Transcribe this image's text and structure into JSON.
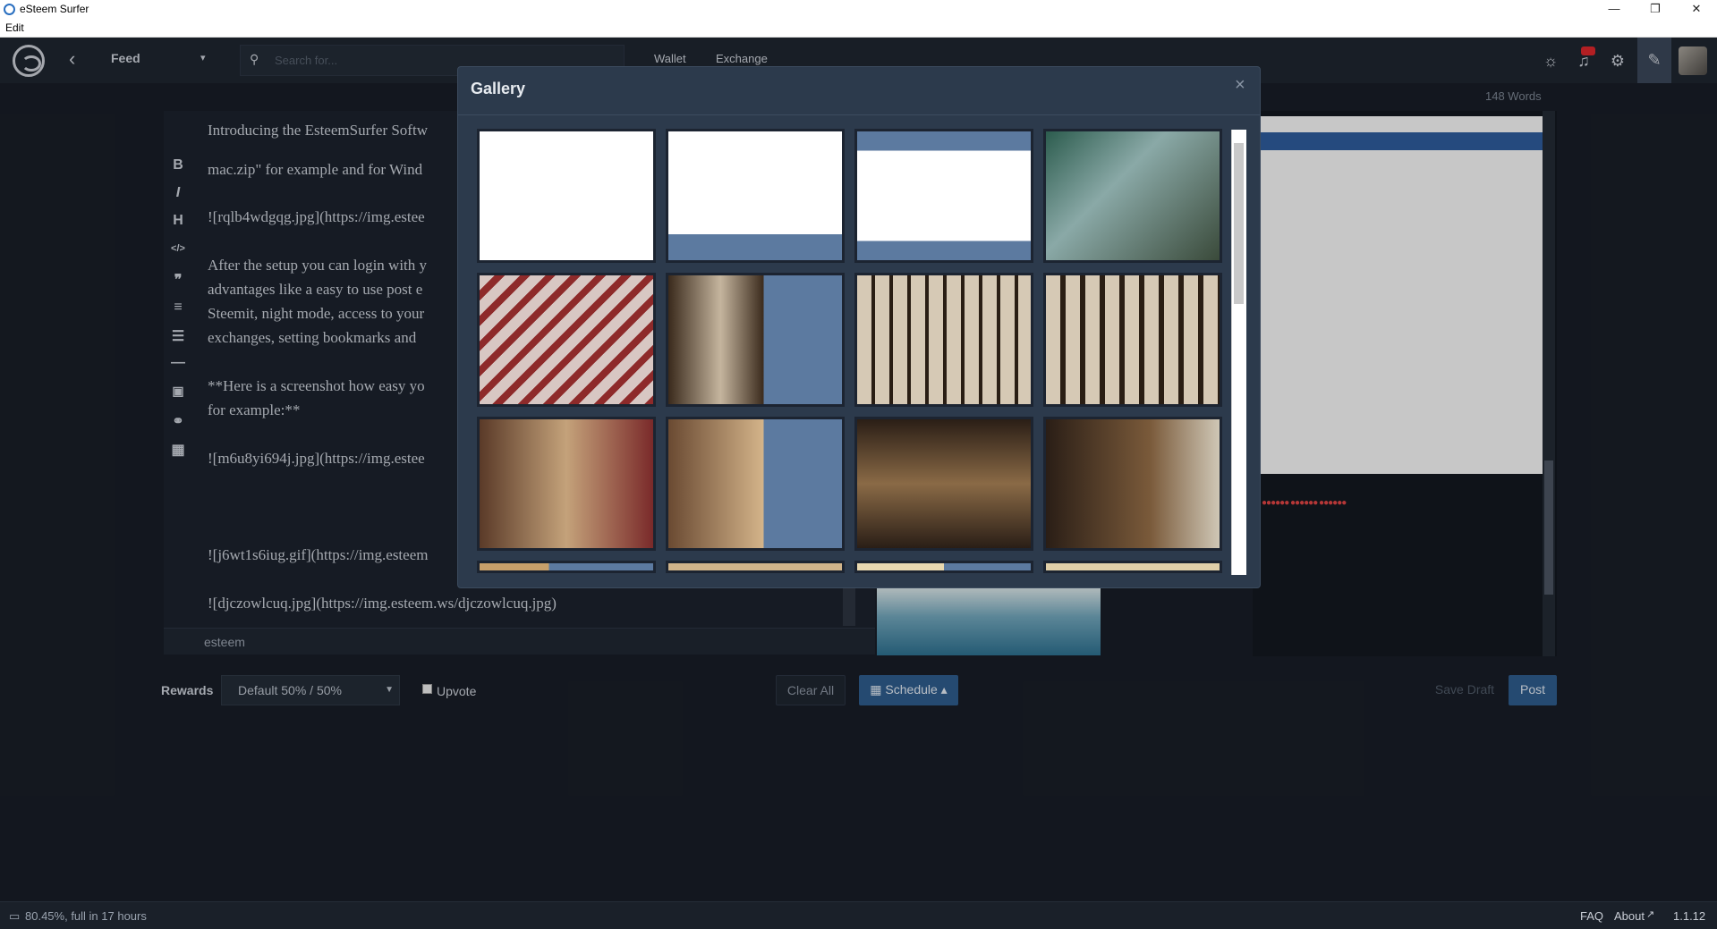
{
  "window": {
    "title": "eSteem Surfer",
    "menu": "Edit",
    "min": "—",
    "max": "❐",
    "close": "✕"
  },
  "nav": {
    "back": "‹",
    "feed": "Feed",
    "caret": "▾",
    "search_placeholder": "Search for...",
    "wallet": "Wallet",
    "exchange": "Exchange",
    "icons": [
      "back-icon",
      "search-icon",
      "sun-icon",
      "bell-icon",
      "gear-icon",
      "pencil-icon"
    ]
  },
  "editor": {
    "word_count": "148 Words",
    "toolbar": [
      "B",
      "I",
      "H",
      "</>",
      "❞",
      "≡",
      "☰",
      "—",
      "▣",
      "⚭",
      "▦"
    ],
    "lines": [
      "Introducing the EsteemSurfer Softw",
      "mac.zip\" for example and for Wind",
      "![rqlb4wdgqg.jpg](https://img.estee",
      "After the setup you can login with y",
      "advantages like a easy to use post e",
      "Steemit, night mode, access to your",
      "exchanges, setting bookmarks and",
      "**Here is a screenshot how easy yo",
      "for example:**",
      "![m6u8yi694j.jpg](https://img.estee",
      "![j6wt1s6iug.gif](https://img.esteem",
      "![djczowlcuq.jpg](https://img.esteem.ws/djczowlcuq.jpg)"
    ],
    "tags": "esteem"
  },
  "controls": {
    "rewards_label": "Rewards",
    "rewards_value": "Default 50% / 50%",
    "upvote": "Upvote",
    "clear_all": "Clear All",
    "schedule": "Schedule",
    "save_draft": "Save Draft",
    "post": "Post"
  },
  "status": {
    "battery": "80.45%, full in 17 hours",
    "faq": "FAQ",
    "about": "About",
    "version": "1.1.12"
  },
  "gallery": {
    "title": "Gallery",
    "close": "×",
    "tiles": 16
  },
  "colors": {
    "accent": "#2e5b8a",
    "bg": "#181d26",
    "panel": "#2c3a4c"
  }
}
